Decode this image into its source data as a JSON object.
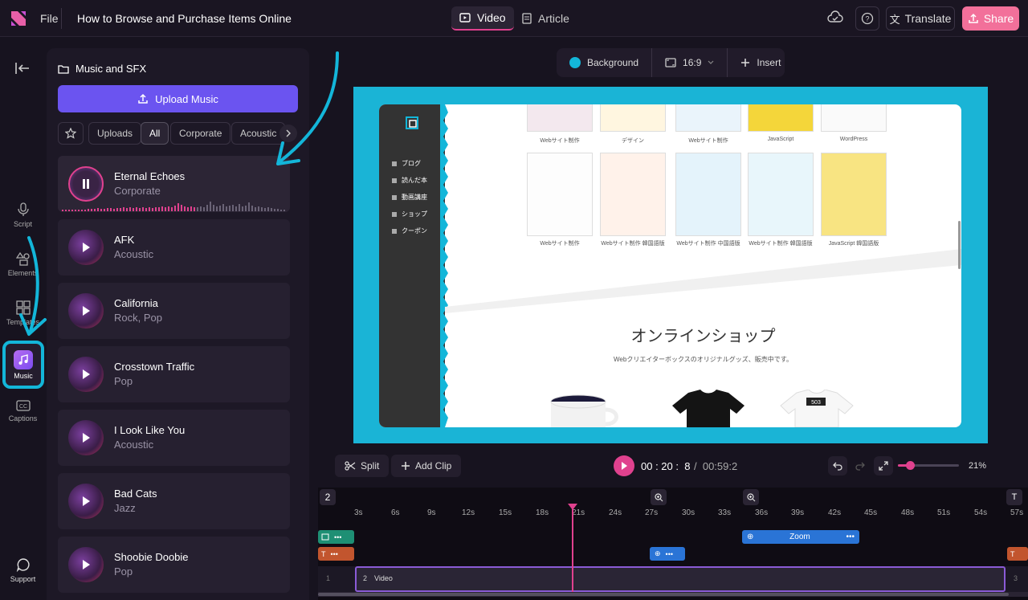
{
  "header": {
    "file_label": "File",
    "doc_title": "How to Browse and Purchase Items Online",
    "tabs": [
      {
        "label": "Video"
      },
      {
        "label": "Article"
      }
    ],
    "translate_label": "Translate",
    "share_label": "Share"
  },
  "rail": {
    "items": [
      {
        "label": "Script"
      },
      {
        "label": "Elements"
      },
      {
        "label": "Templates"
      },
      {
        "label": "Music"
      },
      {
        "label": "Captions"
      },
      {
        "label": "Support"
      }
    ]
  },
  "panel": {
    "title": "Music and SFX",
    "upload_label": "Upload Music",
    "filters": [
      "Uploads",
      "All",
      "Corporate",
      "Acoustic"
    ],
    "tracks": [
      {
        "name": "Eternal Echoes",
        "genre": "Corporate"
      },
      {
        "name": "AFK",
        "genre": "Acoustic"
      },
      {
        "name": "California",
        "genre": "Rock, Pop"
      },
      {
        "name": "Crosstown Traffic",
        "genre": "Pop"
      },
      {
        "name": "I Look Like You",
        "genre": "Acoustic"
      },
      {
        "name": "Bad Cats",
        "genre": "Jazz"
      },
      {
        "name": "Shoobie Doobie",
        "genre": "Pop"
      }
    ]
  },
  "canvas_toolbar": {
    "background_label": "Background",
    "ratio_label": "16:9",
    "insert_label": "Insert",
    "background_color": "#13b6d9"
  },
  "preview": {
    "nav": [
      "ブログ",
      "読んだ本",
      "動画講座",
      "ショップ",
      "クーポン"
    ],
    "top_captions": [
      "Webサイト制作",
      "デザイン",
      "Webサイト制作",
      "JavaScript",
      "WordPress"
    ],
    "book_captions": [
      "Webサイト制作",
      "Webサイト制作 韓国語版",
      "Webサイト制作 中国語版",
      "Webサイト制作 韓国語版",
      "JavaScript 韓国語版"
    ],
    "shop_title": "オンラインショップ",
    "shop_subtitle": "Webクリエイターボックスのオリジナルグッズ、販売中です。"
  },
  "controls": {
    "split_label": "Split",
    "add_clip_label": "Add Clip",
    "time_current": "00 : 20 :  8",
    "time_total": "/  00:59:2",
    "zoom_percent": "21%"
  },
  "timeline": {
    "badge": "2",
    "ticks": [
      "3s",
      "6s",
      "9s",
      "12s",
      "15s",
      "18s",
      "21s",
      "24s",
      "27s",
      "30s",
      "33s",
      "36s",
      "39s",
      "42s",
      "45s",
      "48s",
      "51s",
      "54s",
      "57s"
    ],
    "zoom_clip_label": "Zoom",
    "video_clip_index": "2",
    "video_clip_label": "Video",
    "left_index": "1",
    "right_index": "3"
  }
}
